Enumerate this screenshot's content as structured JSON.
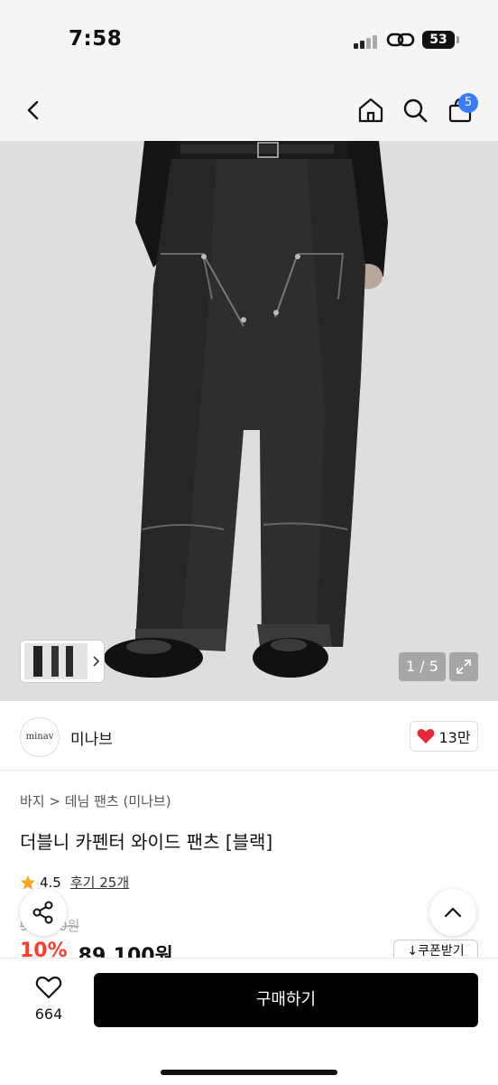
{
  "status": {
    "time": "7:58",
    "battery": "53"
  },
  "nav": {
    "cart_count": "5"
  },
  "gallery": {
    "counter": "1 / 5"
  },
  "brand": {
    "logo_text": "minav",
    "name": "미나브",
    "likes": "13만"
  },
  "product": {
    "breadcrumb_1": "바지",
    "breadcrumb_2": "데님 팬츠 (미나브)",
    "title": "더블니 카펜터 와이드 팬츠 [블랙]",
    "rating": "4.5",
    "reviews": "후기 25개",
    "original_price": "99,000원",
    "discount": "10%",
    "price": "89,100원",
    "coupon": "↓쿠폰받기"
  },
  "bottom": {
    "wish_count": "664",
    "buy_label": "구매하기"
  },
  "colors": {
    "discount_red": "#ff3b30",
    "badge_blue": "#3a7bff",
    "heart_red": "#e8283a",
    "star": "#f6a623"
  }
}
